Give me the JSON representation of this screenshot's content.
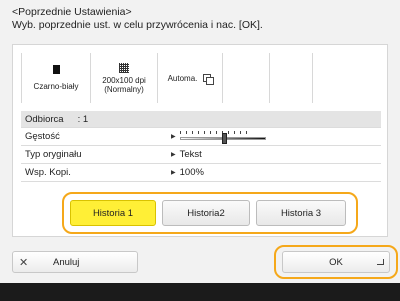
{
  "header": {
    "title": "<Poprzednie Ustawienia>",
    "subtitle": "Wyb. poprzednie ust. w celu przywrócenia i nac. [OK]."
  },
  "settings": {
    "color_mode": "Czarno-biały",
    "resolution_line1": "200x100 dpi",
    "resolution_line2": "(Normalny)",
    "duplex": "Automa."
  },
  "table": {
    "recipient_label": "Odbiorca",
    "recipient_value": ": 1",
    "rows": [
      {
        "label": "Gęstość",
        "value": ""
      },
      {
        "label": "Typ oryginału",
        "value": "Tekst"
      },
      {
        "label": "Wsp. Kopi.",
        "value": "100%"
      }
    ],
    "density_level": 0.5
  },
  "history": {
    "buttons": [
      "Historia 1",
      "Historia2",
      "Historia 3"
    ],
    "selected_index": 0
  },
  "actions": {
    "cancel_label": "Anuluj",
    "ok_label": "OK"
  },
  "colors": {
    "accent_orange": "#f5a81a",
    "selected_yellow": "#ffef36"
  }
}
